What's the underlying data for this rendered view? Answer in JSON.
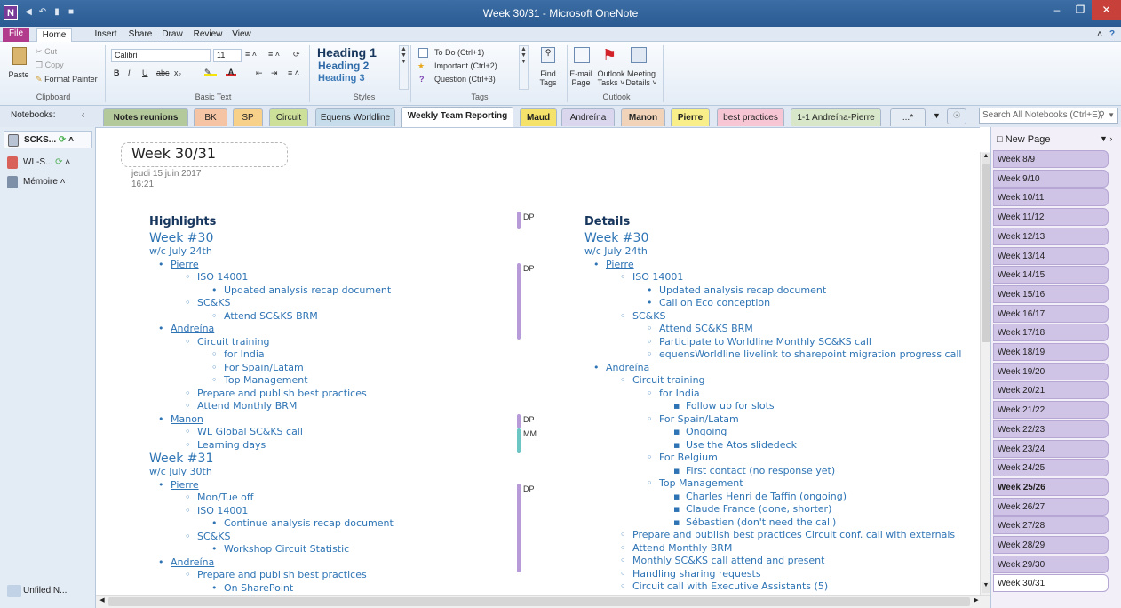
{
  "window": {
    "title": "Week 30/31 - Microsoft OneNote",
    "app_letter": "N"
  },
  "ribbon_tabs": [
    "File",
    "Home",
    "Insert",
    "Share",
    "Draw",
    "Review",
    "View"
  ],
  "clipboard": {
    "paste": "Paste",
    "cut": "Cut",
    "copy": "Copy",
    "format_painter": "Format Painter",
    "label": "Clipboard"
  },
  "basic_text": {
    "font": "Calibri",
    "size": "11",
    "label": "Basic Text",
    "bold": "B",
    "italic": "I",
    "underline": "U"
  },
  "styles": {
    "h1": "Heading 1",
    "h2": "Heading 2",
    "h3": "Heading 3",
    "label": "Styles"
  },
  "tags": {
    "todo": "To Do (Ctrl+1)",
    "important": "Important (Ctrl+2)",
    "question": "Question (Ctrl+3)",
    "find": "Find Tags",
    "find1": "Find",
    "find2": "Tags",
    "label": "Tags"
  },
  "outlook": {
    "email1": "E-mail",
    "email2": "Page",
    "tasks1": "Outlook",
    "tasks2": "Tasks ˅",
    "meeting1": "Meeting",
    "meeting2": "Details ˅",
    "label": "Outlook"
  },
  "notebooks": {
    "label": "Notebooks:",
    "items": [
      "SCKS...",
      "WL-S...",
      "Mémoire"
    ],
    "unfiled": "Unfiled N..."
  },
  "section_tabs": [
    {
      "label": "Notes reunions",
      "color": "#b4c99b",
      "bold": true
    },
    {
      "label": "BK",
      "color": "#f4c4a4"
    },
    {
      "label": "SP",
      "color": "#f7d08a"
    },
    {
      "label": "Circuit",
      "color": "#cde09a"
    },
    {
      "label": "Equens Worldline",
      "color": "#c7dceb"
    },
    {
      "label": "Weekly Team Reporting",
      "color": "#ffffff",
      "bold": true
    },
    {
      "label": "Maud",
      "color": "#f5e26a",
      "bold": true
    },
    {
      "label": "Andreína",
      "color": "#d9d6ee"
    },
    {
      "label": "Manon",
      "color": "#f0d3b8",
      "bold": true
    },
    {
      "label": "Pierre",
      "color": "#f9ef8a",
      "bold": true
    },
    {
      "label": "best practices",
      "color": "#f6c6d4"
    },
    {
      "label": "1-1 Andreína-Pierre",
      "color": "#d8e7c9"
    },
    {
      "label": "...*",
      "color": "#e6ecf3"
    }
  ],
  "search": {
    "placeholder": "Search All Notebooks (Ctrl+E)"
  },
  "page": {
    "title": "Week 30/31",
    "date": "jeudi 15 juin 2017",
    "time": "16:21",
    "left": [
      {
        "t": "Highlights",
        "cls": "h1",
        "lvl": 0
      },
      {
        "t": "Week #30",
        "cls": "h2",
        "lvl": 0
      },
      {
        "t": "w/c July 24th",
        "cls": "sub",
        "lvl": 0
      },
      {
        "t": "Pierre",
        "lvl": 1,
        "u": true
      },
      {
        "t": "ISO 14001",
        "lvl": 2
      },
      {
        "t": "Updated analysis recap document",
        "lvl": 3
      },
      {
        "t": "SC&KS",
        "lvl": 2
      },
      {
        "t": "Attend SC&KS BRM",
        "lvl": 3,
        "circle": true
      },
      {
        "t": "Andreína",
        "lvl": 1,
        "u": true
      },
      {
        "t": "Circuit training",
        "lvl": 2
      },
      {
        "t": "for India",
        "lvl": 3,
        "circle": true
      },
      {
        "t": "For Spain/Latam",
        "lvl": 3,
        "circle": true
      },
      {
        "t": "Top Management",
        "lvl": 3,
        "circle": true
      },
      {
        "t": "Prepare and publish best practices",
        "lvl": 2
      },
      {
        "t": "Attend Monthly BRM",
        "lvl": 2
      },
      {
        "t": "Manon",
        "lvl": 1,
        "u": true
      },
      {
        "t": "WL Global SC&KS call",
        "lvl": 2
      },
      {
        "t": "Learning days",
        "lvl": 2
      },
      {
        "t": "Week #31",
        "cls": "h2",
        "lvl": 0
      },
      {
        "t": "w/c July 30th",
        "cls": "sub",
        "lvl": 0
      },
      {
        "t": "Pierre",
        "lvl": 1,
        "u": true
      },
      {
        "t": "Mon/Tue off",
        "lvl": 2
      },
      {
        "t": "ISO 14001",
        "lvl": 2
      },
      {
        "t": "Continue analysis recap document",
        "lvl": 3
      },
      {
        "t": "SC&KS",
        "lvl": 2
      },
      {
        "t": "Workshop Circuit Statistic",
        "lvl": 3
      },
      {
        "t": "Andreína",
        "lvl": 1,
        "u": true
      },
      {
        "t": "Prepare and publish best practices",
        "lvl": 2
      },
      {
        "t": "On SharePoint",
        "lvl": 3
      }
    ],
    "right": [
      {
        "t": "Details",
        "cls": "h1",
        "lvl": 0
      },
      {
        "t": "Week #30",
        "cls": "h2",
        "lvl": 0
      },
      {
        "t": "w/c July 24th",
        "cls": "sub",
        "lvl": 0
      },
      {
        "t": "Pierre",
        "lvl": 1,
        "u": true
      },
      {
        "t": "ISO 14001",
        "lvl": 2
      },
      {
        "t": "Updated analysis recap document",
        "lvl": 3
      },
      {
        "t": "Call on Eco conception",
        "lvl": 3
      },
      {
        "t": "SC&KS",
        "lvl": 2
      },
      {
        "t": "Attend SC&KS BRM",
        "lvl": 3,
        "circle": true
      },
      {
        "t": "Participate to Worldline Monthly SC&KS call",
        "lvl": 3,
        "circle": true
      },
      {
        "t": "equensWorldline livelink to sharepoint migration progress call",
        "lvl": 3,
        "circle": true
      },
      {
        "t": "Andreína",
        "lvl": 1,
        "u": true
      },
      {
        "t": "Circuit training",
        "lvl": 2
      },
      {
        "t": "for India",
        "lvl": 3,
        "circle": true
      },
      {
        "t": "Follow up for slots",
        "lvl": 4
      },
      {
        "t": "For Spain/Latam",
        "lvl": 3,
        "circle": true
      },
      {
        "t": "Ongoing",
        "lvl": 4
      },
      {
        "t": "Use the Atos slidedeck",
        "lvl": 4
      },
      {
        "t": "For Belgium",
        "lvl": 3,
        "circle": true
      },
      {
        "t": "First contact (no response yet)",
        "lvl": 4
      },
      {
        "t": "Top Management",
        "lvl": 3,
        "circle": true
      },
      {
        "t": "Charles Henri de Taffin (ongoing)",
        "lvl": 4
      },
      {
        "t": "Claude France (done, shorter)",
        "lvl": 4
      },
      {
        "t": "Sébastien (don't need the call)",
        "lvl": 4
      },
      {
        "t": "Prepare and publish best practices Circuit conf. call with externals",
        "lvl": 2
      },
      {
        "t": "Attend Monthly BRM",
        "lvl": 2
      },
      {
        "t": "Monthly SC&KS call attend and present",
        "lvl": 2
      },
      {
        "t": "Handling sharing requests",
        "lvl": 2
      },
      {
        "t": "Circuit call with Executive Assistants (5)",
        "lvl": 2
      }
    ],
    "tags": [
      {
        "label": "DP",
        "color": "#b79bd9"
      },
      {
        "label": "DP",
        "color": "#b79bd9"
      },
      {
        "label": "DP",
        "color": "#b79bd9"
      },
      {
        "label": "MM",
        "color": "#6cc6c4"
      },
      {
        "label": "DP",
        "color": "#b79bd9"
      }
    ]
  },
  "pages": {
    "new_page": "New Page",
    "items": [
      "Week 8/9",
      "Week 9/10",
      "Week 10/11",
      "Week 11/12",
      "Week 12/13",
      "Week 13/14",
      "Week 14/15",
      "Week 15/16",
      "Week 16/17",
      "Week 17/18",
      "Week 18/19",
      "Week 19/20",
      "Week 20/21",
      "Week 21/22",
      "Week 22/23",
      "Week 23/24",
      "Week 24/25",
      "Week 25/26",
      "Week 26/27",
      "Week 27/28",
      "Week 28/29",
      "Week 29/30",
      "Week 30/31"
    ],
    "bold": "Week 25/26",
    "selected": "Week 30/31"
  }
}
